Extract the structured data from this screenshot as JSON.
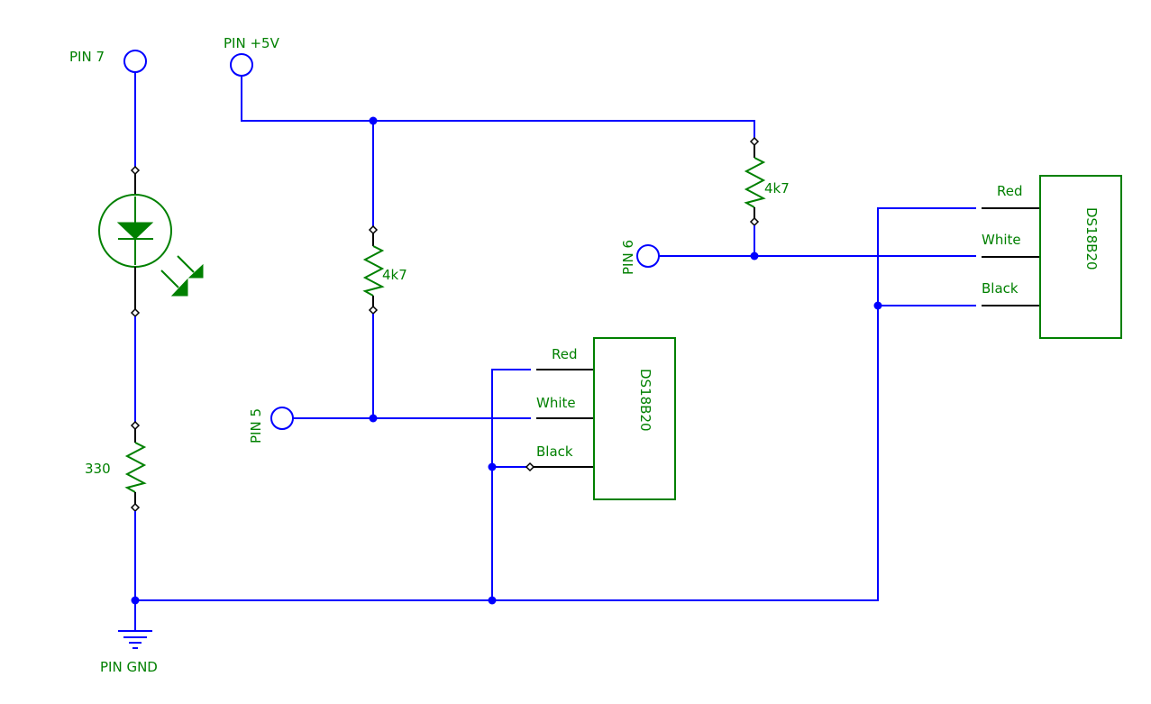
{
  "diagram": {
    "type": "circuit-schematic",
    "colors": {
      "wire": "#0000ff",
      "component": "#008000",
      "lead": "#000000",
      "label": "#008000"
    },
    "pins": {
      "pin7": "PIN 7",
      "pin5v": "PIN +5V",
      "pin5": "PIN 5",
      "pin6": "PIN 6",
      "gnd": "PIN GND"
    },
    "components": {
      "led": {
        "kind": "photo/LED diode",
        "icon": "led-icon"
      },
      "r_led": {
        "kind": "resistor",
        "value": "330"
      },
      "r_pullup_1": {
        "kind": "resistor",
        "value": "4k7"
      },
      "r_pullup_2": {
        "kind": "resistor",
        "value": "4k7"
      },
      "sensor_1": {
        "name": "DS18B20",
        "wires": [
          "Red",
          "White",
          "Black"
        ]
      },
      "sensor_2": {
        "name": "DS18B20",
        "wires": [
          "Red",
          "White",
          "Black"
        ]
      }
    }
  }
}
